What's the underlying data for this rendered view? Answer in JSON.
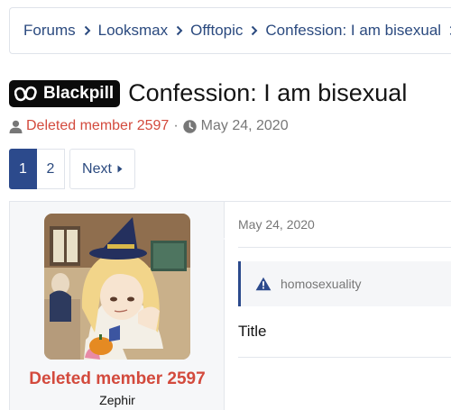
{
  "breadcrumb": [
    {
      "label": "Forums"
    },
    {
      "label": "Looksmax"
    },
    {
      "label": "Offtopic"
    },
    {
      "label": "Confession: I am bisexual"
    }
  ],
  "thread": {
    "prefix": "Blackpill",
    "title": "Confession: I am bisexual",
    "author": "Deleted member 2597",
    "separator": "·",
    "date": "May 24, 2020"
  },
  "pagination": {
    "pages": [
      "1",
      "2"
    ],
    "current": "1",
    "next_label": "Next"
  },
  "post": {
    "username": "Deleted member 2597",
    "user_title": "Zephir",
    "date": "May 24, 2020",
    "tag": "homosexuality",
    "body": "Title"
  },
  "colors": {
    "link": "#2b4a7f",
    "accent": "#2c4a8c",
    "username": "#d34a3d",
    "muted": "#777777",
    "prefix_bg": "#0b0b0b"
  },
  "icons": {
    "breadcrumb_separator": "chevron-right-icon",
    "author": "user-icon",
    "date": "clock-icon",
    "next": "caret-right-icon",
    "notice": "warning-icon",
    "prefix_logo": "blackpill-logo-icon"
  }
}
